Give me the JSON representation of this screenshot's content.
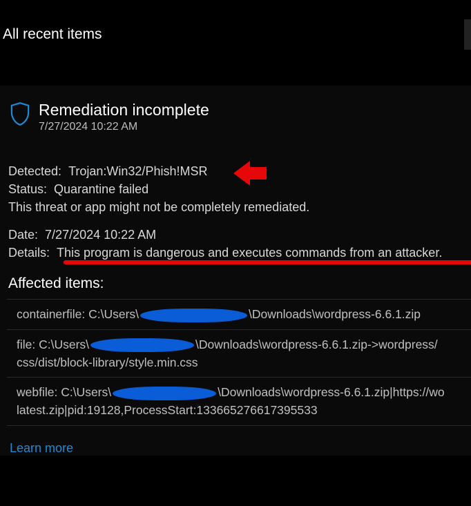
{
  "header": {
    "title": "All recent items"
  },
  "card": {
    "title": "Remediation incomplete",
    "timestamp": "7/27/2024 10:22 AM",
    "detected_label": "Detected:",
    "detected_value": "Trojan:Win32/Phish!MSR",
    "status_label": "Status:",
    "status_value": "Quarantine failed",
    "summary": "This threat or app might not be completely remediated.",
    "date_label": "Date:",
    "date_value": "7/27/2024 10:22 AM",
    "details_label": "Details:",
    "details_value": "This program is dangerous and executes commands from an attacker.",
    "affected_heading": "Affected items:",
    "affected_items": [
      {
        "prefix": "containerfile: C:\\Users\\",
        "suffix": "\\Downloads\\wordpress-6.6.1.zip"
      },
      {
        "prefix": "file: C:\\Users\\",
        "suffix": "\\Downloads\\wordpress-6.6.1.zip->wordpress/",
        "line2": "css/dist/block-library/style.min.css"
      },
      {
        "prefix": "webfile: C:\\Users\\",
        "suffix": "\\Downloads\\wordpress-6.6.1.zip|https://wo",
        "line2": "latest.zip|pid:19128,ProcessStart:133665276617395533"
      }
    ],
    "learn_more": "Learn more"
  },
  "icons": {
    "shield": "shield-icon"
  },
  "annotations": {
    "arrow": "red-arrow",
    "underline": "red-underline"
  }
}
